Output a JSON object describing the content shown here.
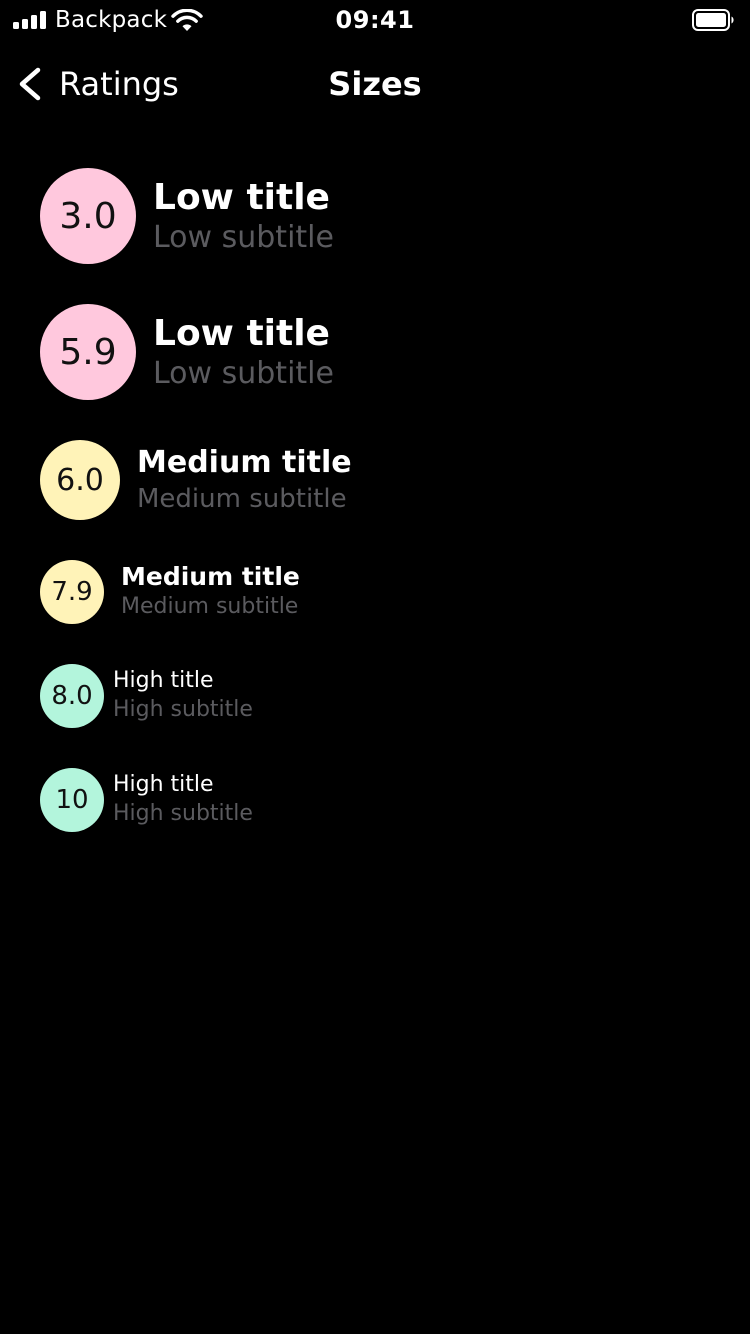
{
  "status_bar": {
    "carrier": "Backpack",
    "time": "09:41"
  },
  "nav": {
    "back_label": "Ratings",
    "title": "Sizes"
  },
  "colors": {
    "low": "#ffc8dd",
    "medium": "#fff3b8",
    "high": "#b3f5dc",
    "subtitle": "#5b5b5f",
    "background": "#000000"
  },
  "ratings": [
    {
      "value": "3.0",
      "title": "Low title",
      "subtitle": "Low subtitle",
      "level": "low"
    },
    {
      "value": "5.9",
      "title": "Low title",
      "subtitle": "Low subtitle",
      "level": "low"
    },
    {
      "value": "6.0",
      "title": "Medium title",
      "subtitle": "Medium subtitle",
      "level": "medium"
    },
    {
      "value": "7.9",
      "title": "Medium title",
      "subtitle": "Medium subtitle",
      "level": "medium"
    },
    {
      "value": "8.0",
      "title": "High title",
      "subtitle": "High subtitle",
      "level": "high"
    },
    {
      "value": "10",
      "title": "High title",
      "subtitle": "High subtitle",
      "level": "high"
    }
  ]
}
